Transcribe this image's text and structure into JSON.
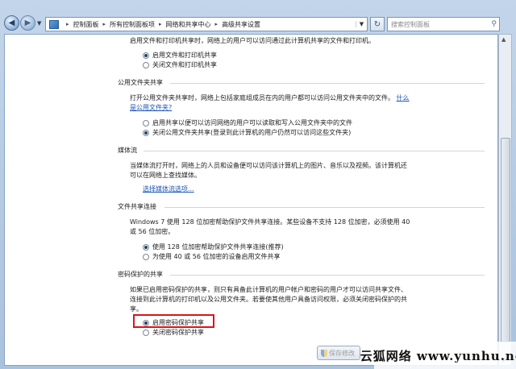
{
  "address_bar": {
    "crumbs": [
      "控制面板",
      "所有控制面板项",
      "网络和共享中心",
      "高级共享设置"
    ],
    "search_placeholder": "搜索控制面板"
  },
  "sections": {
    "file_printer_sharing": {
      "description": "启用文件和打印机共享时，网络上的用户可以访问通过此计算机共享的文件和打印机。",
      "options": [
        {
          "label": "启用文件和打印机共享",
          "selected": true
        },
        {
          "label": "关闭文件和打印机共享",
          "selected": false
        }
      ]
    },
    "public_folder_sharing": {
      "title": "公用文件夹共享",
      "description_line1": "打开公用文件夹共享时，网络上包括家庭组成员在内的用户都可以访问公用文件夹中的文件。",
      "link_part1": "什么",
      "link_part2": "是公用文件夹?",
      "options": [
        {
          "label": "启用共享以便可以访问网络的用户可以读取和写入公用文件夹中的文件",
          "selected": false
        },
        {
          "label": "关闭公用文件夹共享(登录到此计算机的用户仍然可以访问这些文件夹)",
          "selected": true
        }
      ]
    },
    "media_streaming": {
      "title": "媒体流",
      "description_line1": "当媒体流打开时，网络上的人员和设备便可以访问该计算机上的图片、音乐以及视频。该计算机还",
      "description_line2": "可以在网络上查找媒体。",
      "link": "选择媒体流选项..."
    },
    "file_sharing_connections": {
      "title": "文件共享连接",
      "description_line1": "Windows 7 使用 128 位加密帮助保护文件共享连接。某些设备不支持 128 位加密，必须使用 40",
      "description_line2": "或 56 位加密。",
      "options": [
        {
          "label": "使用 128 位加密帮助保护文件共享连接(推荐)",
          "selected": true
        },
        {
          "label": "为使用 40 或 56 位加密的设备启用文件共享",
          "selected": false
        }
      ]
    },
    "password_protected_sharing": {
      "title": "密码保护的共享",
      "description_line1": "如果已启用密码保护的共享，则只有具备此计算机的用户帐户和密码的用户才可以访问共享文件、",
      "description_line2": "连接到此计算机的打印机以及公用文件夹。若要使其他用户具备访问权限，必须关闭密码保护的共",
      "description_line3": "享。",
      "options": [
        {
          "label": "启用密码保护共享",
          "selected": true
        },
        {
          "label": "关闭密码保护共享",
          "selected": false
        }
      ]
    }
  },
  "buttons": {
    "save_label": "保存修改"
  },
  "watermark": "云狐网络 www.yunhu.net"
}
